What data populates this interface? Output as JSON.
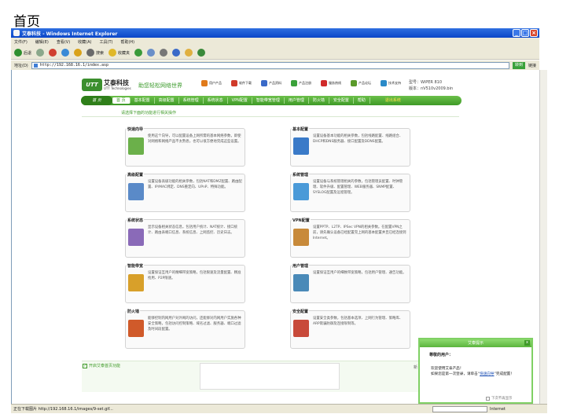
{
  "page_heading": "首页",
  "window": {
    "title": "艾泰科技 - Windows Internet Explorer"
  },
  "menu": [
    "文件(F)",
    "编辑(E)",
    "查看(V)",
    "收藏(A)",
    "工具(T)",
    "帮助(H)"
  ],
  "toolbar": [
    {
      "label": "后退",
      "icon": "back-icon",
      "color": "#2f8f2f"
    },
    {
      "label": "",
      "icon": "forward-icon",
      "color": "#8ba88b"
    },
    {
      "label": "",
      "icon": "stop-icon",
      "color": "#d04030"
    },
    {
      "label": "",
      "icon": "refresh-icon",
      "color": "#3a8ad6"
    },
    {
      "label": "",
      "icon": "home-icon",
      "color": "#d9a21a"
    },
    {
      "label": "搜索",
      "icon": "search-icon",
      "color": "#6a6a6a"
    },
    {
      "label": "收藏夹",
      "icon": "favorites-icon",
      "color": "#e0b82a"
    },
    {
      "label": "",
      "icon": "history-icon",
      "color": "#3a9a3a"
    },
    {
      "label": "",
      "icon": "mail-icon",
      "color": "#6a8fc8"
    },
    {
      "label": "",
      "icon": "print-icon",
      "color": "#777777"
    },
    {
      "label": "",
      "icon": "edit-icon",
      "color": "#3a6ac8"
    },
    {
      "label": "",
      "icon": "folder-icon",
      "color": "#e0b040"
    },
    {
      "label": "",
      "icon": "messenger-icon",
      "color": "#3a8a3a"
    }
  ],
  "address": {
    "label": "地址(D)",
    "url": "http://192.168.16.1/index.asp",
    "go": "转到",
    "links": "链接"
  },
  "brand": {
    "logo": "UTT",
    "name": "艾泰科技",
    "sub": "UTT Technologies",
    "slogan": "助您轻松网络世界"
  },
  "toplinks": [
    {
      "label": "用户产品",
      "color": "#e07a1a"
    },
    {
      "label": "软件下载",
      "color": "#d03a2a"
    },
    {
      "label": "产品资料",
      "color": "#3a6ac8"
    },
    {
      "label": "产品注册",
      "color": "#3aa13a"
    },
    {
      "label": "服务热线",
      "color": "#d02a2a"
    },
    {
      "label": "产品论坛",
      "color": "#5a9a2a"
    },
    {
      "label": "技术支持",
      "color": "#2a8ac8"
    }
  ],
  "model": {
    "line1": "型号：WiPER 810",
    "line2": "版本：nV510v2009.bin"
  },
  "nav": {
    "home": "首 页",
    "items": [
      "首 页",
      "基本配置",
      "高级配置",
      "系统管理",
      "系统状态",
      "VPN配置",
      "智能带宽管理",
      "用户管理",
      "防火墙",
      "安全配置",
      "帮助"
    ],
    "exit": "退出系统"
  },
  "hint": "请选择下面的功能进行相关操作",
  "cards": [
    {
      "title": "快速向导",
      "icon_color": "#6bb04a",
      "desc": "使用这个向导，可以配置设备上网所需的基本网络参数，即使对网络和网络产品不太熟悉，也可以很方便地完成这些设置。"
    },
    {
      "title": "基本配置",
      "icon_color": "#3a7ac8",
      "desc": "设置设备基本功能的相关参数，包括线路配置、线路组合、DHCP和DNS服务器、接口配置及DDNS配置。"
    },
    {
      "title": "高级配置",
      "icon_color": "#5a8ac8",
      "desc": "设置设备高级功能的相关参数，包括NAT和DMZ配置、路由配置、IP/MAC绑定、DNS重定向、UPnP、特殊功能。"
    },
    {
      "title": "系统管理",
      "icon_color": "#4a9ad8",
      "desc": "设置设备与系统管理相关的参数，包括管理员配置、时钟管理、软件升级、配置管理、WEB服务器、SNMP配置、SYSLOG配置及远程管理。"
    },
    {
      "title": "系统状态",
      "icon_color": "#8a6ab8",
      "desc": "显示设备相关状态信息，包括用户统计、NAT统计、接口统计、路由表端口信息、系统信息、上网监控、历史日志。"
    },
    {
      "title": "VPN配置",
      "icon_color": "#c88a3a",
      "desc": "设置PPTP、L2TP、IPSec VPN的相关参数。在配置VPN之前，请先确认设备已经配置完上网的基本配置并且已经连接到Internet。"
    },
    {
      "title": "智能带宽",
      "icon_color": "#d8a02a",
      "desc": "设置保证互用户的精细带宽策略，包括限速及流量配置、精准抢用、P2P限速。"
    },
    {
      "title": "用户管理",
      "icon_color": "#4a8ab8",
      "desc": "设置保证互用户的细致带宽策略，包括用户管理、通告功能。"
    },
    {
      "title": "防火墙",
      "icon_color": "#d05a2a",
      "desc": "能够控制内网用户对外网的访问，还能够对内网用户实施各种安全策略，包括访问控制策略、域名过滤、服务器、端口过滤及时间段配置。"
    },
    {
      "title": "安全配置",
      "icon_color": "#c84a3a",
      "desc": "设置安全类参数，包括基本选项、上网行为管理、策略库、ARP欺骗防御及连接限制等。"
    }
  ],
  "bottom": {
    "checkbox_label": "开启艾泰首页功能",
    "edge": "新"
  },
  "popup": {
    "title": "艾泰提示",
    "close": "x",
    "greeting": "尊敬的用户：",
    "line1": "欢迎使用艾泰产品！",
    "line2": "如果您是第一次登录，请单击“",
    "link": "快速向导",
    "line3": "”完成配置！",
    "foot": "下次不再显示"
  },
  "status": {
    "text": "正在下载图片 http://192.168.16.1/images/9-set.gif...",
    "zone": "Internet"
  }
}
